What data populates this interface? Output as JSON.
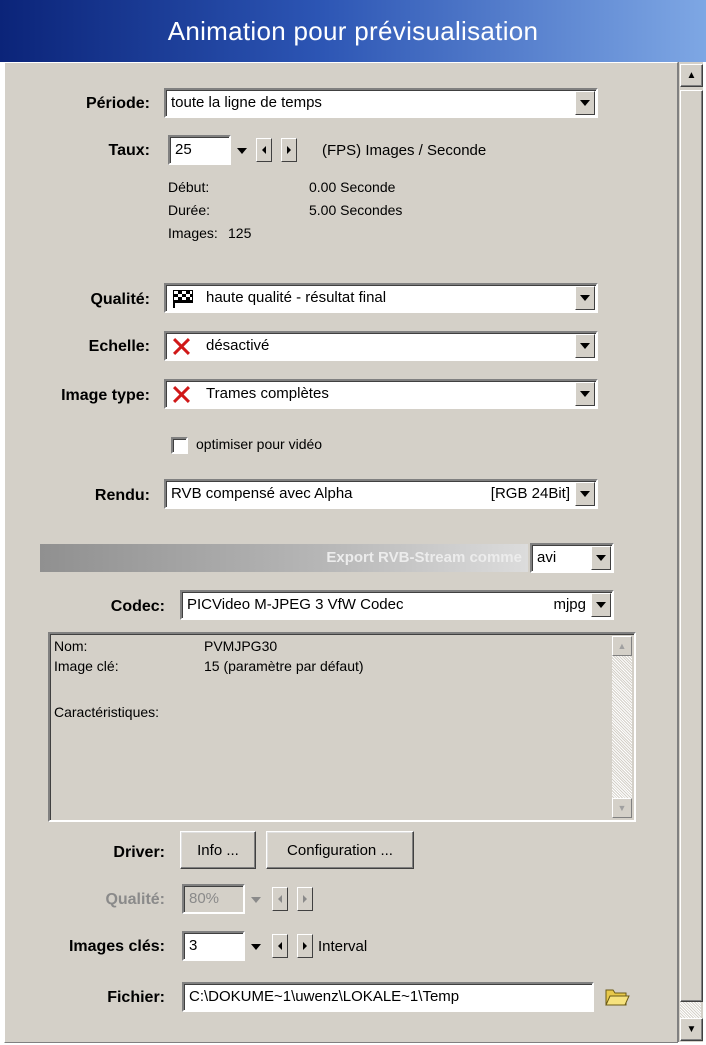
{
  "window": {
    "title": "Animation pour prévisualisation"
  },
  "periode": {
    "label": "Période:",
    "value": "toute la ligne de temps"
  },
  "taux": {
    "label": "Taux:",
    "value": "25",
    "unit": "(FPS) Images / Seconde"
  },
  "timing": {
    "debut_label": "Début:",
    "debut_value": "0.00 Seconde",
    "duree_label": "Durée:",
    "duree_value": "5.00 Secondes",
    "images_label": "Images:",
    "images_value": "125"
  },
  "qualite": {
    "label": "Qualité:",
    "value": "haute qualité - résultat final",
    "icon": "checkered-flag-icon"
  },
  "echelle": {
    "label": "Echelle:",
    "value": "désactivé",
    "icon": "red-x-icon"
  },
  "image_type": {
    "label": "Image type:",
    "value": "Trames complètes",
    "icon": "red-x-icon"
  },
  "optimiser": {
    "label": "optimiser pour vidéo",
    "checked": false
  },
  "rendu": {
    "label": "Rendu:",
    "value": "RVB compensé avec Alpha",
    "tag": "[RGB 24Bit]"
  },
  "export": {
    "label": "Export RVB-Stream comme",
    "format": "avi"
  },
  "codec": {
    "label": "Codec:",
    "value": "PICVideo M-JPEG 3 VfW Codec",
    "tag": "mjpg",
    "info": {
      "nom_label": "Nom:",
      "nom_value": "PVMJPG30",
      "cle_label": "Image clé:",
      "cle_value": "15 (paramètre par défaut)",
      "carac_label": "Caractéristiques:"
    }
  },
  "driver": {
    "label": "Driver:",
    "info_button": "Info ...",
    "config_button": "Configuration ..."
  },
  "qualite_codec": {
    "label": "Qualité:",
    "value": "80%",
    "enabled": false
  },
  "images_cles": {
    "label": "Images clés:",
    "value": "3",
    "suffix": "Interval"
  },
  "fichier": {
    "label": "Fichier:",
    "value": "C:\\DOKUME~1\\uwenz\\LOKALE~1\\Temp",
    "icon": "folder-icon"
  },
  "colors": {
    "panel": "#d4d0c8",
    "title_gradient_start": "#0b2479",
    "title_gradient_end": "#7ea7e4",
    "icon_red": "#d01818"
  }
}
